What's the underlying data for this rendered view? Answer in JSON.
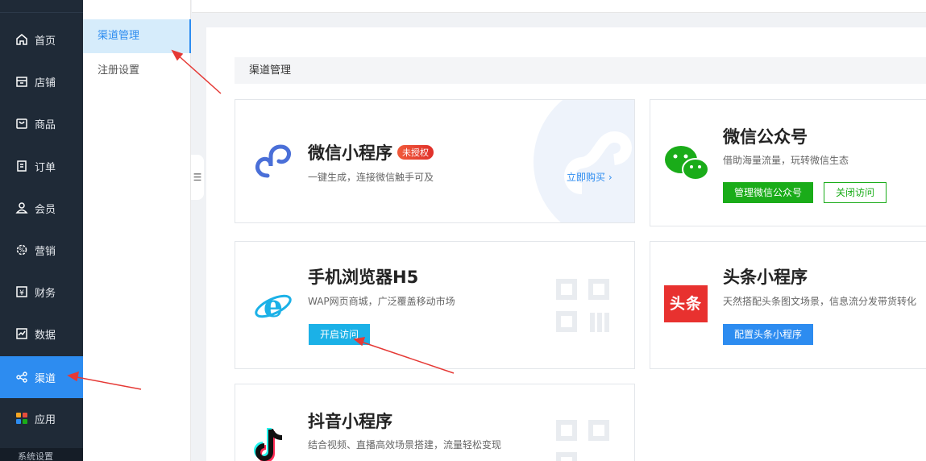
{
  "nav": {
    "items": [
      {
        "label": "首页",
        "icon": "home-icon"
      },
      {
        "label": "店铺",
        "icon": "store-icon"
      },
      {
        "label": "商品",
        "icon": "goods-icon"
      },
      {
        "label": "订单",
        "icon": "order-icon"
      },
      {
        "label": "会员",
        "icon": "member-icon"
      },
      {
        "label": "营销",
        "icon": "marketing-icon"
      },
      {
        "label": "财务",
        "icon": "finance-icon"
      },
      {
        "label": "数据",
        "icon": "data-icon"
      },
      {
        "label": "渠道",
        "icon": "channel-icon",
        "active": true
      },
      {
        "label": "应用",
        "icon": "apps-icon"
      }
    ],
    "bottom_label": "系统设置"
  },
  "subnav": {
    "items": [
      {
        "label": "渠道管理",
        "active": true
      },
      {
        "label": "注册设置"
      }
    ]
  },
  "main": {
    "section_title": "渠道管理",
    "cards": {
      "weapp": {
        "title": "微信小程序",
        "badge": "未授权",
        "desc": "一键生成，连接微信触手可及",
        "link": "立即购买"
      },
      "mp": {
        "title": "微信公众号",
        "desc": "借助海量流量，玩转微信生态",
        "primary_button": "管理微信公众号",
        "secondary_button": "关闭访问"
      },
      "h5": {
        "title": "手机浏览器H5",
        "desc": "WAP网页商城，广泛覆盖移动市场",
        "button": "开启访问"
      },
      "toutiao": {
        "title": "头条小程序",
        "desc": "天然搭配头条图文场景，信息流分发带货转化",
        "button": "配置头条小程序",
        "logo_text": "头条"
      },
      "douyin": {
        "title": "抖音小程序",
        "desc": "结合视频、直播高效场景搭建，流量轻松变现"
      }
    }
  },
  "colors": {
    "accent": "#2d8cf0",
    "nav_bg": "#1f2a37",
    "wechat_green": "#1aac19",
    "annotation": "#e53935"
  }
}
